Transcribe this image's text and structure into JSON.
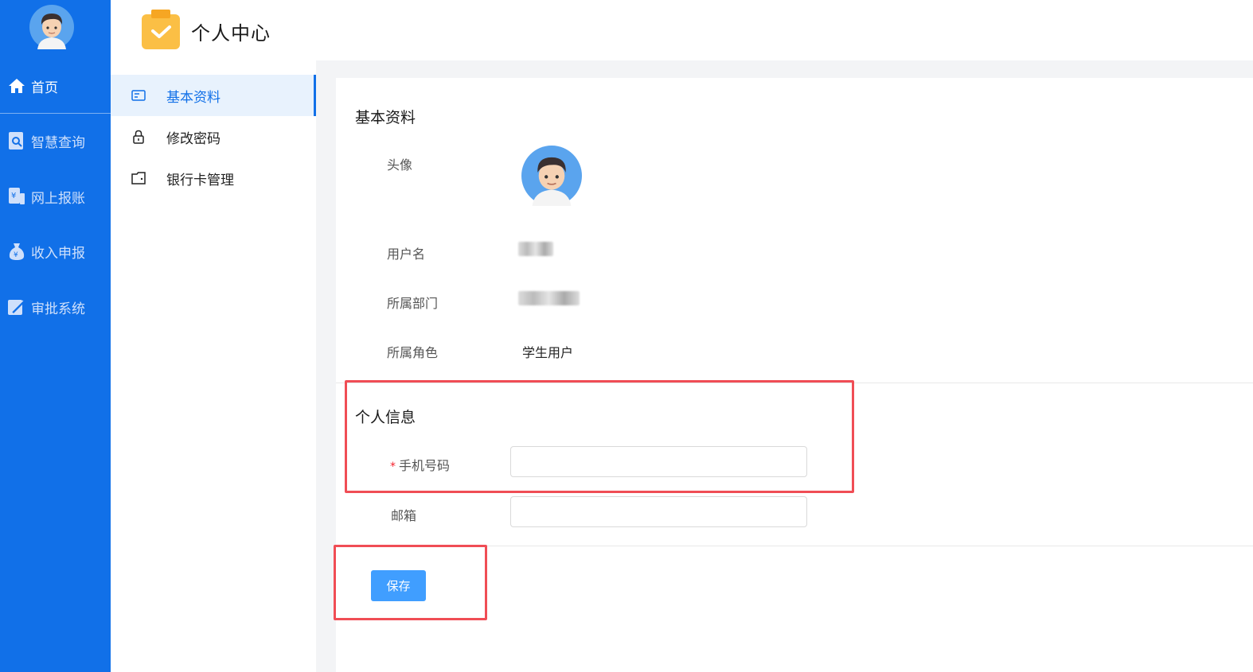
{
  "nav": {
    "items": [
      {
        "label": "首页",
        "icon": "home-icon"
      },
      {
        "label": "智慧查询",
        "icon": "search-doc-icon"
      },
      {
        "label": "网上报账",
        "icon": "yen-doc-icon"
      },
      {
        "label": "收入申报",
        "icon": "money-bag-icon"
      },
      {
        "label": "审批系统",
        "icon": "pen-icon"
      }
    ]
  },
  "header": {
    "title": "个人中心"
  },
  "submenu": {
    "items": [
      {
        "label": "基本资料",
        "active": true
      },
      {
        "label": "修改密码",
        "active": false
      },
      {
        "label": "银行卡管理",
        "active": false
      }
    ]
  },
  "basic": {
    "title": "基本资料",
    "avatar_label": "头像",
    "username_label": "用户名",
    "dept_label": "所属部门",
    "role_label": "所属角色",
    "role_value": "学生用户"
  },
  "personal": {
    "title": "个人信息",
    "phone_label": "手机号码",
    "required_mark": "*",
    "phone_value": "",
    "email_label": "邮箱",
    "email_value": ""
  },
  "actions": {
    "save_label": "保存"
  },
  "colors": {
    "nav_bg": "#1170e8",
    "accent": "#409eff",
    "highlight": "#f04d55"
  }
}
